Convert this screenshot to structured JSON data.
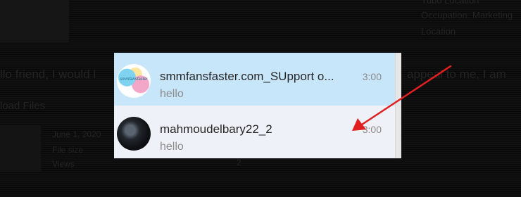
{
  "background": {
    "profile_lines": [
      "Yubo Location",
      "Occupation: Marketing",
      "Location"
    ],
    "message_line_left": "llo friend, I would l",
    "message_line_right": "appeal to me, I am",
    "link_text": "load Files",
    "file_lines": [
      "June 1, 2020",
      "File size",
      "Views"
    ],
    "stray_number": "2"
  },
  "chat_list": {
    "items": [
      {
        "name": "smmfansfaster.com_SUpport o...",
        "preview": "hello",
        "time": "3:00",
        "avatar_text": "smmfansfaster",
        "selected": true
      },
      {
        "name": "mahmoudelbary22_2",
        "preview": "hello",
        "time": "3:00",
        "selected": false
      }
    ]
  },
  "annotation": {
    "arrow_color": "#e02020"
  },
  "colors": {
    "selected_row": "#c8e6fa",
    "unselected_row": "#eef2f8",
    "name_text": "#262626",
    "muted_text": "#8c8c8c"
  }
}
